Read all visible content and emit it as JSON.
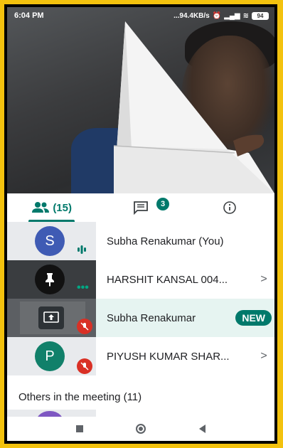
{
  "status_bar": {
    "time": "6:04 PM",
    "network_speed": "...94.4KB/s",
    "battery": "94"
  },
  "tabs": [
    {
      "name": "people",
      "count": "(15)",
      "active": true
    },
    {
      "name": "chat",
      "badge": "3",
      "active": false
    },
    {
      "name": "info",
      "active": false
    }
  ],
  "participants": [
    {
      "initial": "S",
      "avatar_color": "#3f5bb4",
      "name": "Subha Renakumar (You)",
      "state": "speaking"
    },
    {
      "initial": "",
      "avatar_color": "#111111",
      "name": "HARSHIT KANSAL 004...",
      "state": "pinned",
      "chevron": ">"
    },
    {
      "initial": "",
      "avatar_color": "#2d3236",
      "name": "Subha Renakumar",
      "state": "presenting",
      "badge": "NEW"
    },
    {
      "initial": "P",
      "avatar_color": "#11806a",
      "name": "PIYUSH KUMAR SHAR...",
      "state": "muted",
      "chevron": ">"
    }
  ],
  "others_heading": "Others in the meeting (11)",
  "colors": {
    "accent": "#00796b",
    "mute_red": "#d93025",
    "frame_yellow": "#f3c20e"
  }
}
